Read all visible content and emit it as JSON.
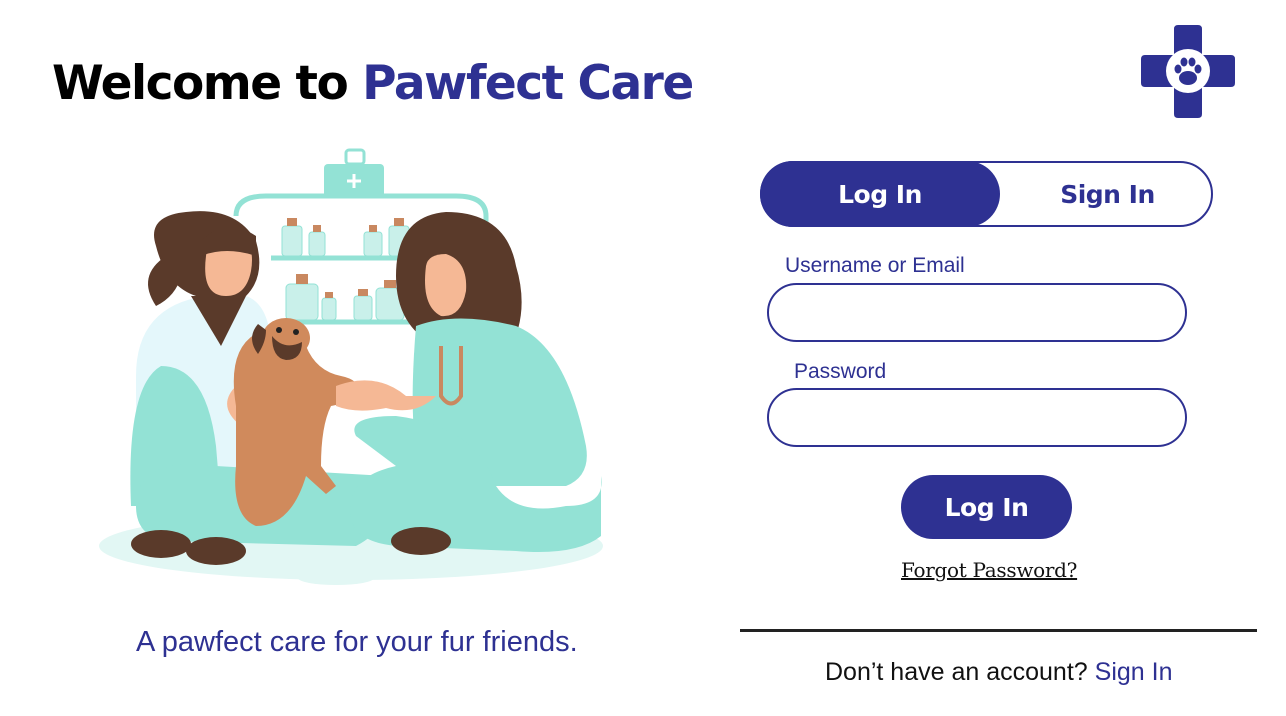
{
  "header": {
    "title_prefix": "Welcome to ",
    "title_brand": "Pawfect Care"
  },
  "hero": {
    "tagline": "A pawfect care for your fur friends."
  },
  "auth": {
    "tabs": [
      {
        "label": "Log In",
        "active": true
      },
      {
        "label": "Sign In",
        "active": false
      }
    ],
    "username_label": "Username or Email",
    "username_value": "",
    "password_label": "Password",
    "password_value": "",
    "submit_label": "Log In",
    "forgot_label": "Forgot Password?",
    "signup_prompt": "Don’t have an account?",
    "signup_link": "Sign In"
  },
  "icons": {
    "logo": "medical-cross-paw-icon",
    "illustration": "vets-with-dog-illustration"
  },
  "colors": {
    "brand": "#2e3192",
    "mint": "#93e2d5",
    "hair": "#5a3a2a",
    "skin": "#f5b895",
    "dog": "#d08a5c"
  }
}
